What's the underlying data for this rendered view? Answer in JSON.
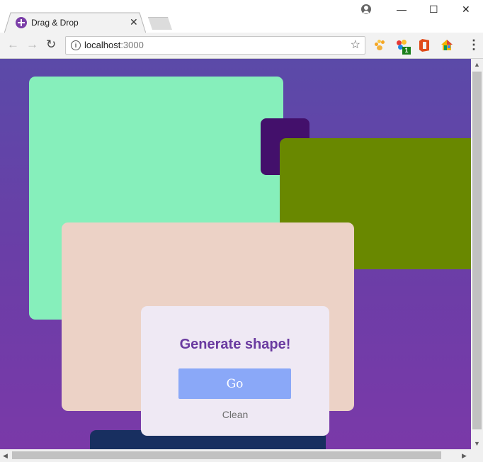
{
  "browser": {
    "tab_title": "Drag & Drop",
    "tab_close": "✕",
    "url_host": "localhost",
    "url_port": ":3000",
    "back_icon": "←",
    "forward_icon": "→",
    "reload_icon": "↻",
    "star_icon": "☆",
    "menu_icon": "⋮",
    "minimize_icon": "—",
    "maximize_icon": "☐",
    "close_icon": "✕",
    "extension_badge": "1",
    "info_icon": "i"
  },
  "panel": {
    "title": "Generate shape!",
    "go_label": "Go",
    "clean_label": "Clean"
  },
  "scroll": {
    "up": "▲",
    "down": "▼",
    "left": "◀",
    "right": "▶"
  },
  "colors": {
    "mint": "#86efbb",
    "dark_purple": "#43106b",
    "olive": "#698800",
    "peach": "#ecd2c6",
    "navy": "#182f60",
    "button": "#8aa8f8"
  }
}
